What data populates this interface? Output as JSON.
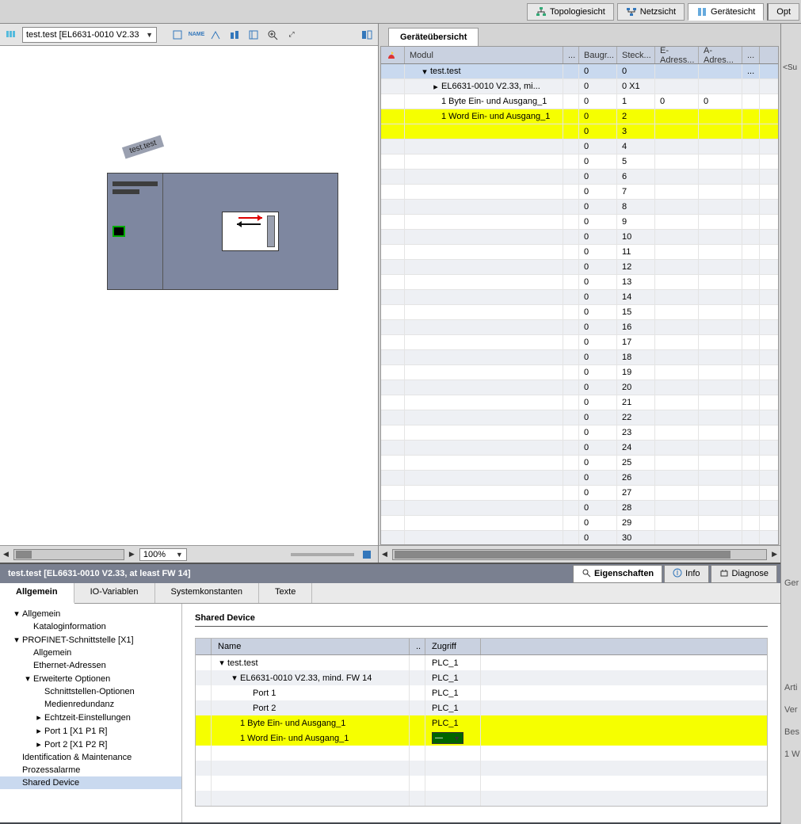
{
  "topTabs": {
    "topology": "Topologiesicht",
    "network": "Netzsicht",
    "device": "Gerätesicht",
    "options": "Opt"
  },
  "toolbar": {
    "deviceSelect": "test.test [EL6631-0010 V2.33"
  },
  "canvas": {
    "rackLabel": "test.test"
  },
  "zoom": "100%",
  "overviewTab": "Geräteübersicht",
  "gridHeaders": {
    "module": "Modul",
    "dots": "...",
    "rack": "Baugr...",
    "slot": "Steck...",
    "iaddr": "E-Adress...",
    "qaddr": "A-Adres...",
    "end": "..."
  },
  "gridRows": [
    {
      "indent": 1,
      "exp": "▾",
      "name": "test.test",
      "rack": "0",
      "slot": "0",
      "i": "",
      "q": "",
      "sel": true,
      "end": "..."
    },
    {
      "indent": 2,
      "exp": "▸",
      "name": "EL6631-0010 V2.33, mi...",
      "rack": "0",
      "slot": "0 X1",
      "i": "",
      "q": ""
    },
    {
      "indent": 2,
      "exp": "",
      "name": "1 Byte Ein- und Ausgang_1",
      "rack": "0",
      "slot": "1",
      "i": "0",
      "q": "0"
    },
    {
      "indent": 2,
      "exp": "",
      "name": "1 Word Ein- und Ausgang_1",
      "rack": "0",
      "slot": "2",
      "i": "",
      "q": "",
      "hl": true
    },
    {
      "indent": 2,
      "exp": "",
      "name": "",
      "rack": "0",
      "slot": "3",
      "i": "",
      "q": "",
      "hl": true
    },
    {
      "indent": 2,
      "exp": "",
      "name": "",
      "rack": "0",
      "slot": "4",
      "i": "",
      "q": ""
    },
    {
      "indent": 2,
      "exp": "",
      "name": "",
      "rack": "0",
      "slot": "5",
      "i": "",
      "q": ""
    },
    {
      "indent": 2,
      "exp": "",
      "name": "",
      "rack": "0",
      "slot": "6",
      "i": "",
      "q": ""
    },
    {
      "indent": 2,
      "exp": "",
      "name": "",
      "rack": "0",
      "slot": "7",
      "i": "",
      "q": ""
    },
    {
      "indent": 2,
      "exp": "",
      "name": "",
      "rack": "0",
      "slot": "8",
      "i": "",
      "q": ""
    },
    {
      "indent": 2,
      "exp": "",
      "name": "",
      "rack": "0",
      "slot": "9",
      "i": "",
      "q": ""
    },
    {
      "indent": 2,
      "exp": "",
      "name": "",
      "rack": "0",
      "slot": "10",
      "i": "",
      "q": ""
    },
    {
      "indent": 2,
      "exp": "",
      "name": "",
      "rack": "0",
      "slot": "11",
      "i": "",
      "q": ""
    },
    {
      "indent": 2,
      "exp": "",
      "name": "",
      "rack": "0",
      "slot": "12",
      "i": "",
      "q": ""
    },
    {
      "indent": 2,
      "exp": "",
      "name": "",
      "rack": "0",
      "slot": "13",
      "i": "",
      "q": ""
    },
    {
      "indent": 2,
      "exp": "",
      "name": "",
      "rack": "0",
      "slot": "14",
      "i": "",
      "q": ""
    },
    {
      "indent": 2,
      "exp": "",
      "name": "",
      "rack": "0",
      "slot": "15",
      "i": "",
      "q": ""
    },
    {
      "indent": 2,
      "exp": "",
      "name": "",
      "rack": "0",
      "slot": "16",
      "i": "",
      "q": ""
    },
    {
      "indent": 2,
      "exp": "",
      "name": "",
      "rack": "0",
      "slot": "17",
      "i": "",
      "q": ""
    },
    {
      "indent": 2,
      "exp": "",
      "name": "",
      "rack": "0",
      "slot": "18",
      "i": "",
      "q": ""
    },
    {
      "indent": 2,
      "exp": "",
      "name": "",
      "rack": "0",
      "slot": "19",
      "i": "",
      "q": ""
    },
    {
      "indent": 2,
      "exp": "",
      "name": "",
      "rack": "0",
      "slot": "20",
      "i": "",
      "q": ""
    },
    {
      "indent": 2,
      "exp": "",
      "name": "",
      "rack": "0",
      "slot": "21",
      "i": "",
      "q": ""
    },
    {
      "indent": 2,
      "exp": "",
      "name": "",
      "rack": "0",
      "slot": "22",
      "i": "",
      "q": ""
    },
    {
      "indent": 2,
      "exp": "",
      "name": "",
      "rack": "0",
      "slot": "23",
      "i": "",
      "q": ""
    },
    {
      "indent": 2,
      "exp": "",
      "name": "",
      "rack": "0",
      "slot": "24",
      "i": "",
      "q": ""
    },
    {
      "indent": 2,
      "exp": "",
      "name": "",
      "rack": "0",
      "slot": "25",
      "i": "",
      "q": ""
    },
    {
      "indent": 2,
      "exp": "",
      "name": "",
      "rack": "0",
      "slot": "26",
      "i": "",
      "q": ""
    },
    {
      "indent": 2,
      "exp": "",
      "name": "",
      "rack": "0",
      "slot": "27",
      "i": "",
      "q": ""
    },
    {
      "indent": 2,
      "exp": "",
      "name": "",
      "rack": "0",
      "slot": "28",
      "i": "",
      "q": ""
    },
    {
      "indent": 2,
      "exp": "",
      "name": "",
      "rack": "0",
      "slot": "29",
      "i": "",
      "q": ""
    },
    {
      "indent": 2,
      "exp": "",
      "name": "",
      "rack": "0",
      "slot": "30",
      "i": "",
      "q": ""
    }
  ],
  "inspector": {
    "title": "test.test [EL6631-0010 V2.33, at least FW 14]",
    "tabs": {
      "properties": "Eigenschaften",
      "info": "Info",
      "diag": "Diagnose"
    },
    "subtabs": {
      "general": "Allgemein",
      "iovars": "IO-Variablen",
      "sysconst": "Systemkonstanten",
      "texts": "Texte"
    },
    "nav": [
      {
        "l": 0,
        "exp": "▾",
        "t": "Allgemein"
      },
      {
        "l": 1,
        "exp": "",
        "t": "Kataloginformation"
      },
      {
        "l": 0,
        "exp": "▾",
        "t": "PROFINET-Schnittstelle [X1]"
      },
      {
        "l": 1,
        "exp": "",
        "t": "Allgemein"
      },
      {
        "l": 1,
        "exp": "",
        "t": "Ethernet-Adressen"
      },
      {
        "l": 1,
        "exp": "▾",
        "t": "Erweiterte Optionen"
      },
      {
        "l": 2,
        "exp": "",
        "t": "Schnittstellen-Optionen"
      },
      {
        "l": 2,
        "exp": "",
        "t": "Medienredundanz"
      },
      {
        "l": 2,
        "exp": "▸",
        "t": "Echtzeit-Einstellungen"
      },
      {
        "l": 2,
        "exp": "▸",
        "t": "Port 1 [X1 P1 R]"
      },
      {
        "l": 2,
        "exp": "▸",
        "t": "Port 2 [X1 P2 R]"
      },
      {
        "l": 0,
        "exp": "",
        "t": "Identification & Maintenance"
      },
      {
        "l": 0,
        "exp": "",
        "t": "Prozessalarme"
      },
      {
        "l": 0,
        "exp": "",
        "t": "Shared Device",
        "sel": true
      }
    ],
    "sectionTitle": "Shared Device",
    "sharedHead": {
      "name": "Name",
      "dots": "..",
      "access": "Zugriff"
    },
    "sharedRows": [
      {
        "indent": 0,
        "exp": "▾",
        "name": "test.test",
        "acc": "PLC_1"
      },
      {
        "indent": 1,
        "exp": "▾",
        "name": "EL6631-0010 V2.33, mind. FW 14",
        "acc": "PLC_1"
      },
      {
        "indent": 2,
        "exp": "",
        "name": "Port 1",
        "acc": "PLC_1"
      },
      {
        "indent": 2,
        "exp": "",
        "name": "Port 2",
        "acc": "PLC_1"
      },
      {
        "indent": 1,
        "exp": "",
        "name": "1 Byte Ein- und Ausgang_1",
        "acc": "PLC_1",
        "hl": true
      },
      {
        "indent": 1,
        "exp": "",
        "name": "1 Word Ein- und Ausgang_1",
        "acc": "—",
        "hl": true,
        "dd": true
      }
    ],
    "rightLabels": {
      "ger": "Ger",
      "art": "Arti",
      "ver": "Ver",
      "bes": "Bes",
      "w": "1 W"
    }
  },
  "rightSide": {
    "su": "<Su"
  }
}
